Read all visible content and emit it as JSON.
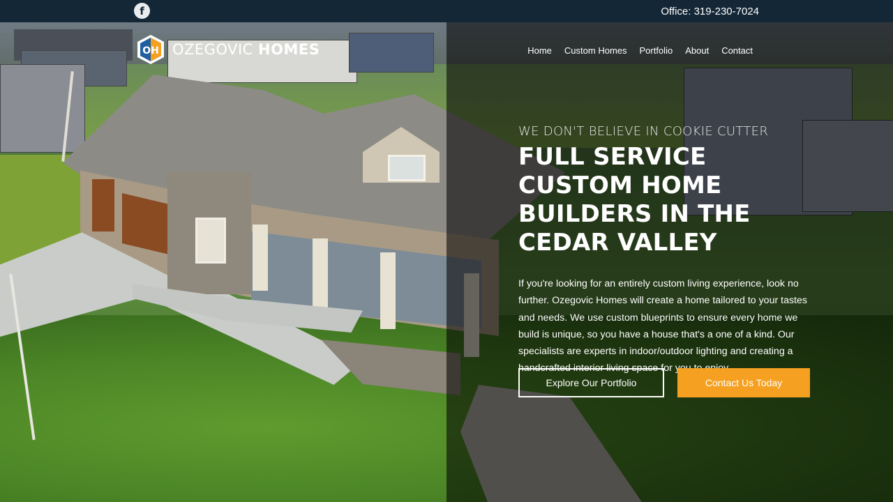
{
  "topbar": {
    "facebook_icon": "facebook-icon",
    "phone": "Office: 319-230-7024"
  },
  "brand": {
    "name_part1": "OZEGOVIC",
    "name_part2": "HOMES",
    "logo_mark": "OH",
    "colors": {
      "hex_outline": "#ffffff",
      "hex_fill_blue": "#1e5fa0",
      "hex_fill_orange": "#f5a021"
    }
  },
  "nav": {
    "items": [
      {
        "label": "Home"
      },
      {
        "label": "Custom Homes"
      },
      {
        "label": "Portfolio"
      },
      {
        "label": "About"
      },
      {
        "label": "Contact"
      }
    ]
  },
  "hero": {
    "eyebrow": "WE DON'T BELIEVE IN COOKIE CUTTER",
    "headline": "FULL SERVICE CUSTOM HOME BUILDERS IN THE CEDAR VALLEY",
    "body": "If you're looking for an entirely custom living experience, look no further. Ozegovic Homes will create a home tailored to your tastes and needs. We use custom blueprints to ensure every home we build is unique, so you have a house that's a one of a kind. Our specialists are experts in indoor/outdoor lighting and creating a handcrafted interior living space for you to enjoy.",
    "buttons": {
      "portfolio": "Explore Our Portfolio",
      "contact": "Contact Us Today"
    }
  },
  "theme": {
    "topbar_bg": "#142736",
    "accent": "#f5a021",
    "text": "#ffffff"
  }
}
